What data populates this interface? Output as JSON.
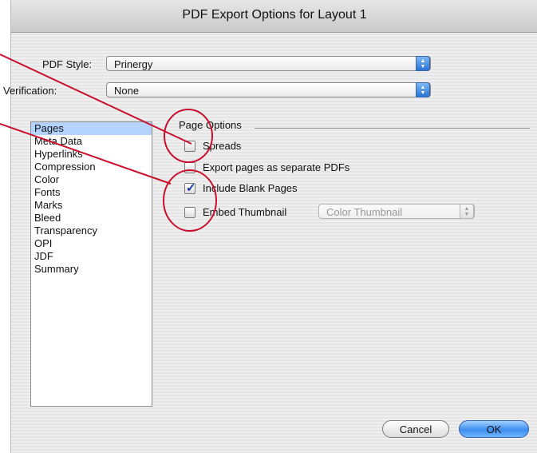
{
  "dialog": {
    "title": "PDF Export Options for Layout 1",
    "pdf_style": {
      "label": "PDF Style:",
      "value": "Prinergy"
    },
    "verification": {
      "label": "Verification:",
      "value": "None"
    },
    "sidebar": {
      "items": [
        {
          "label": "Pages",
          "selected": true
        },
        {
          "label": "Meta Data"
        },
        {
          "label": "Hyperlinks"
        },
        {
          "label": "Compression"
        },
        {
          "label": "Color"
        },
        {
          "label": "Fonts"
        },
        {
          "label": "Marks"
        },
        {
          "label": "Bleed"
        },
        {
          "label": "Transparency"
        },
        {
          "label": "OPI"
        },
        {
          "label": "JDF"
        },
        {
          "label": "Summary"
        }
      ]
    },
    "page_options": {
      "group_label": "Page Options",
      "spreads": {
        "label": "Spreads",
        "checked": false
      },
      "separate_pdfs": {
        "label": "Export pages as separate PDFs",
        "checked": false
      },
      "blank_pages": {
        "label": "Include Blank Pages",
        "checked": true
      },
      "thumbnail": {
        "label": "Embed Thumbnail",
        "checked": false,
        "popup_value": "Color Thumbnail"
      }
    },
    "buttons": {
      "cancel": "Cancel",
      "ok": "OK"
    },
    "annotation_color": "#c8102e"
  }
}
